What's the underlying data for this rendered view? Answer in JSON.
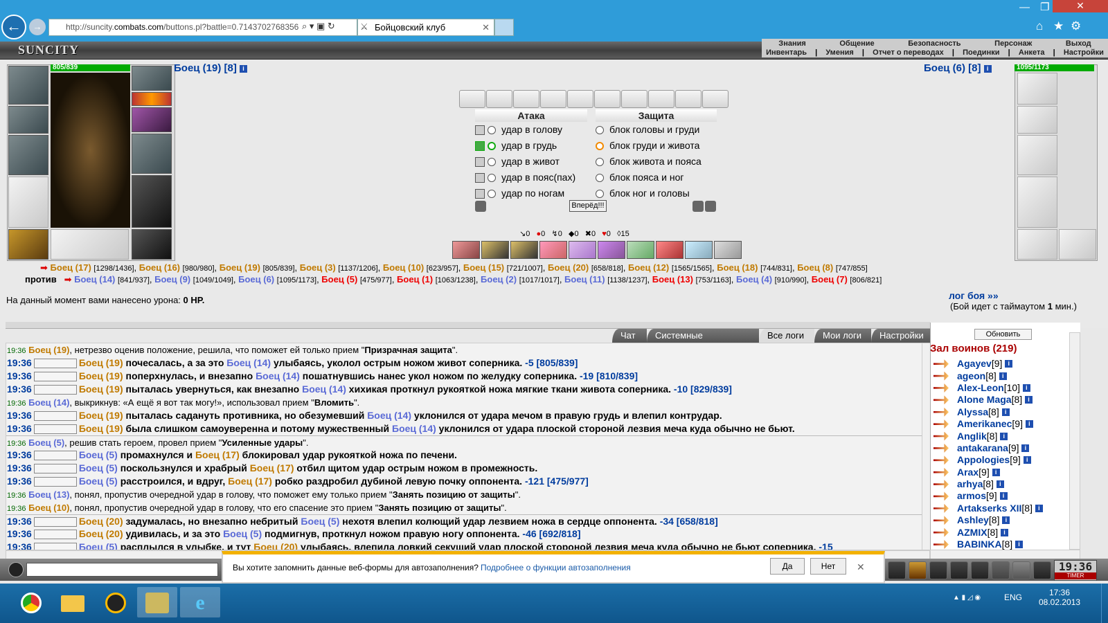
{
  "browser": {
    "url_pre": "http://suncity.",
    "url_host": "combats.com",
    "url_post": "/buttons.pl?battle=0.7143702768356",
    "tab_title": "Бойцовский клуб"
  },
  "game": {
    "logo": "SUNCITY",
    "menu_top": [
      "Знания",
      "Общение",
      "Безопасность",
      "Персонаж",
      "Выход"
    ],
    "menu_bottom": [
      "Инвентарь",
      "Умения",
      "Отчет о переводах",
      "Поединки",
      "Анкета",
      "Настройки"
    ]
  },
  "player_left": {
    "name": "Боец (19) [8]",
    "hp": "805/839"
  },
  "player_right": {
    "name": "Боец (6) [8]",
    "hp": "1095/1173"
  },
  "attack": {
    "title": "Атака",
    "options": [
      "удар в голову",
      "удар в грудь",
      "удар в живот",
      "удар в пояс(пах)",
      "удар по ногам"
    ]
  },
  "defense": {
    "title": "Защита",
    "options": [
      "блок головы и груди",
      "блок груди и живота",
      "блок живота и пояса",
      "блок пояса и ног",
      "блок ног и головы"
    ]
  },
  "go_button": "Вперёд!!!",
  "stats": [
    "0",
    "0",
    "0",
    "0",
    "0",
    "0",
    "15"
  ],
  "team1": [
    [
      "Боец (17)",
      "[1298/1436]"
    ],
    [
      "Боец (16)",
      "[980/980]"
    ],
    [
      "Боец (19)",
      "[805/839]"
    ],
    [
      "Боец (3)",
      "[1137/1206]"
    ],
    [
      "Боец (10)",
      "[623/957]"
    ],
    [
      "Боец (15)",
      "[721/1007]"
    ],
    [
      "Боец (20)",
      "[658/818]"
    ],
    [
      "Боец (12)",
      "[1565/1565]"
    ],
    [
      "Боец (18)",
      "[744/831]"
    ],
    [
      "Боец (8)",
      "[747/855]"
    ]
  ],
  "vs_label": "против",
  "team2": [
    [
      "Боец (14)",
      "[841/937]",
      "b"
    ],
    [
      "Боец (9)",
      "[1049/1049]",
      "b"
    ],
    [
      "Боец (6)",
      "[1095/1173]",
      "b"
    ],
    [
      "Боец (5)",
      "[475/977]",
      "r"
    ],
    [
      "Боец (1)",
      "[1063/1238]",
      "r"
    ],
    [
      "Боец (2)",
      "[1017/1017]",
      "b"
    ],
    [
      "Боец (11)",
      "[1138/1237]",
      "b"
    ],
    [
      "Боец (13)",
      "[753/1163]",
      "r"
    ],
    [
      "Боец (4)",
      "[910/990]",
      "b"
    ],
    [
      "Боец (7)",
      "[806/821]",
      "r"
    ]
  ],
  "damage_label": "На данный момент вами нанесено урона:",
  "damage_value": "0 HP.",
  "log_link": "лог боя »»",
  "timeout_pre": "(Бой идет с таймаутом",
  "timeout_val": "1",
  "timeout_post": "мин.)",
  "log_tabs": [
    "Чат",
    "Системные сообщения",
    "Все логи",
    "Мои логи",
    "Настройки"
  ],
  "log": [
    {
      "t": "19:36",
      "kind": "s",
      "segs": [
        [
          "Боец (19)",
          "c1"
        ],
        [
          ", нетрезво оценив положение, решила, что поможет ей только прием \"",
          ""
        ],
        [
          "Призрачная защита",
          "f"
        ],
        [
          "\".",
          ""
        ]
      ]
    },
    {
      "t": "19:36",
      "kind": "b",
      "segs": [
        [
          "Боец (19)",
          "c1"
        ],
        [
          " почесалась, а за это ",
          ""
        ],
        [
          "Боец (14)",
          "c2"
        ],
        [
          " улыбаясь, уколол острым ножом живот соперника. ",
          ""
        ],
        [
          "-5 [805/839]",
          "d"
        ]
      ]
    },
    {
      "t": "19:36",
      "kind": "b",
      "segs": [
        [
          "Боец (19)",
          "c1"
        ],
        [
          " поперхнулась, и внезапно ",
          ""
        ],
        [
          "Боец (14)",
          "c2"
        ],
        [
          " пошатнувшись нанес укол ножом по желудку соперника. ",
          ""
        ],
        [
          "-19 [810/839]",
          "d"
        ]
      ]
    },
    {
      "t": "19:36",
      "kind": "b",
      "segs": [
        [
          "Боец (19)",
          "c1"
        ],
        [
          " пыталась увернуться, как внезапно ",
          ""
        ],
        [
          "Боец (14)",
          "c2"
        ],
        [
          " хихикая проткнул рукояткой ножа мягкие ткани живота соперника. ",
          ""
        ],
        [
          "-10 [829/839]",
          "d"
        ]
      ]
    },
    {
      "t": "19:36",
      "kind": "s",
      "segs": [
        [
          "Боец (14)",
          "c2"
        ],
        [
          ", выкрикнув: «А ещё я вот так могу!», использовал прием \"",
          ""
        ],
        [
          "Вломить",
          "f"
        ],
        [
          "\".",
          ""
        ]
      ]
    },
    {
      "t": "19:36",
      "kind": "b",
      "segs": [
        [
          "Боец (19)",
          "c1"
        ],
        [
          " пыталась садануть противника, но обезумевший ",
          ""
        ],
        [
          "Боец (14)",
          "c2"
        ],
        [
          " уклонился от удара мечом в правую грудь и влепил контрудар.",
          ""
        ]
      ]
    },
    {
      "t": "19:36",
      "kind": "b",
      "segs": [
        [
          "Боец (19)",
          "c1"
        ],
        [
          " была слишком самоуверенна и потому мужественный ",
          ""
        ],
        [
          "Боец (14)",
          "c2"
        ],
        [
          " уклонился от удара плоской стороной лезвия меча куда обычно не бьют.",
          ""
        ]
      ]
    },
    {
      "t": "19:36",
      "kind": "s",
      "sep": true,
      "segs": [
        [
          "Боец (5)",
          "c2"
        ],
        [
          ", решив стать героем, провел прием \"",
          ""
        ],
        [
          "Усиленные удары",
          "f"
        ],
        [
          "\".",
          ""
        ]
      ]
    },
    {
      "t": "19:36",
      "kind": "b",
      "segs": [
        [
          "Боец (5)",
          "c2"
        ],
        [
          " промахнулся и ",
          ""
        ],
        [
          "Боец (17)",
          "c1"
        ],
        [
          " блокировал удар рукояткой ножа по печени.",
          ""
        ]
      ]
    },
    {
      "t": "19:36",
      "kind": "b",
      "segs": [
        [
          "Боец (5)",
          "c2"
        ],
        [
          " поскользнулся и храбрый ",
          ""
        ],
        [
          "Боец (17)",
          "c1"
        ],
        [
          " отбил щитом удар острым ножом в промежность.",
          ""
        ]
      ]
    },
    {
      "t": "19:36",
      "kind": "b",
      "segs": [
        [
          "Боец (5)",
          "c2"
        ],
        [
          " расстроился, и вдруг, ",
          ""
        ],
        [
          "Боец (17)",
          "c1"
        ],
        [
          " робко раздробил дубиной левую почку оппонента. ",
          ""
        ],
        [
          "-121 [475/977]",
          "d"
        ]
      ]
    },
    {
      "t": "19:36",
      "kind": "s",
      "segs": [
        [
          "Боец (13)",
          "c2"
        ],
        [
          ", понял, пропустив очередной удар в голову, что поможет ему только прием \"",
          ""
        ],
        [
          "Занять позицию от защиты",
          "f"
        ],
        [
          "\".",
          ""
        ]
      ]
    },
    {
      "t": "19:36",
      "kind": "s",
      "segs": [
        [
          "Боец (10)",
          "c1"
        ],
        [
          ", понял, пропустив очередной удар в голову, что его спасение это прием \"",
          ""
        ],
        [
          "Занять позицию от защиты",
          "f"
        ],
        [
          "\".",
          ""
        ]
      ]
    },
    {
      "t": "19:36",
      "kind": "b",
      "sep": true,
      "segs": [
        [
          "Боец (20)",
          "c1"
        ],
        [
          " задумалась, но внезапно небритый ",
          ""
        ],
        [
          "Боец (5)",
          "c2"
        ],
        [
          " нехотя влепил колющий удар лезвием ножа в сердце оппонента. ",
          ""
        ],
        [
          "-34 [658/818]",
          "d"
        ]
      ]
    },
    {
      "t": "19:36",
      "kind": "b",
      "segs": [
        [
          "Боец (20)",
          "c1"
        ],
        [
          " удивилась, и за это ",
          ""
        ],
        [
          "Боец (5)",
          "c2"
        ],
        [
          " подмигнув, проткнул ножом правую ногу оппонента. ",
          ""
        ],
        [
          "-46 [692/818]",
          "d"
        ]
      ]
    },
    {
      "t": "19:36",
      "kind": "b",
      "segs": [
        [
          "Боец (5)",
          "c2"
        ],
        [
          " расплылся в улыбке, и тут ",
          ""
        ],
        [
          "Боец (20)",
          "c1"
        ],
        [
          " улыбаясь, влепила ловкий секущий удар плоской стороной лезвия меча куда обычно не бьют соперника. ",
          ""
        ],
        [
          "-15",
          "d"
        ]
      ]
    }
  ],
  "refresh_button": "Обновить",
  "hall_title": "Зал воинов (219)",
  "warriors": [
    [
      "Agayev",
      "[9]"
    ],
    [
      "ageon",
      "[8]"
    ],
    [
      "Alex-Leon",
      "[10]"
    ],
    [
      "Alone Maga",
      "[8]"
    ],
    [
      "Alyssa",
      "[8]"
    ],
    [
      "Amerikanec",
      "[9]"
    ],
    [
      "Anglik",
      "[8]"
    ],
    [
      "antakarana",
      "[9]"
    ],
    [
      "Appologies",
      "[9]"
    ],
    [
      "Arax",
      "[9]"
    ],
    [
      "arhya",
      "[8]"
    ],
    [
      "armos",
      "[9]"
    ],
    [
      "Artakserks XII",
      "[8]"
    ],
    [
      "Ashley",
      "[8]"
    ],
    [
      "AZMIX",
      "[8]"
    ],
    [
      "BABINKA",
      "[8]"
    ]
  ],
  "autofill": {
    "question": "Вы хотите запомнить данные веб-формы для автозаполнения?",
    "link": "Подробнее о функции автозаполнения",
    "yes": "Да",
    "no": "Нет"
  },
  "clock": {
    "time": "19:36",
    "label": "TIMER"
  },
  "taskbar": {
    "lang": "ENG",
    "time": "17:36",
    "date": "08.02.2013"
  }
}
